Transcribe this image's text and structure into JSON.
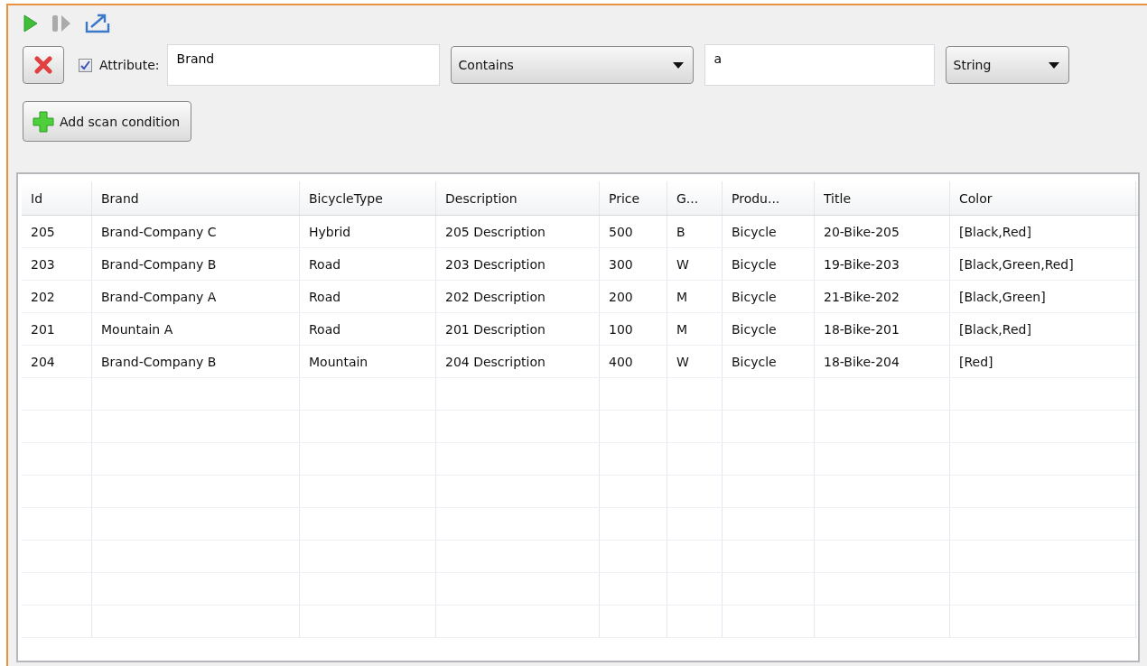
{
  "toolbar": {
    "buttons": [
      {
        "kind": "run"
      },
      {
        "kind": "step"
      },
      {
        "kind": "export"
      }
    ]
  },
  "condition": {
    "enabled": true,
    "attribute_label": "Attribute:",
    "attribute": "Brand",
    "operator": "Contains",
    "value": "a",
    "type": "String"
  },
  "add_button": "Add scan condition",
  "table": {
    "columns": [
      "Id",
      "Brand",
      "BicycleType",
      "Description",
      "Price",
      "G...",
      "Produ...",
      "Title",
      "Color"
    ],
    "rows": [
      [
        "205",
        "Brand-Company C",
        "Hybrid",
        "205 Description",
        "500",
        "B",
        "Bicycle",
        "20-Bike-205",
        "[Black,Red]"
      ],
      [
        "203",
        "Brand-Company B",
        "Road",
        "203 Description",
        "300",
        "W",
        "Bicycle",
        "19-Bike-203",
        "[Black,Green,Red]"
      ],
      [
        "202",
        "Brand-Company A",
        "Road",
        "202 Description",
        "200",
        "M",
        "Bicycle",
        "21-Bike-202",
        "[Black,Green]"
      ],
      [
        "201",
        "Mountain A",
        "Road",
        "201 Description",
        "100",
        "M",
        "Bicycle",
        "18-Bike-201",
        "[Black,Red]"
      ],
      [
        "204",
        "Brand-Company B",
        "Mountain",
        "204 Description",
        "400",
        "W",
        "Bicycle",
        "18-Bike-204",
        "[Red]"
      ]
    ]
  }
}
